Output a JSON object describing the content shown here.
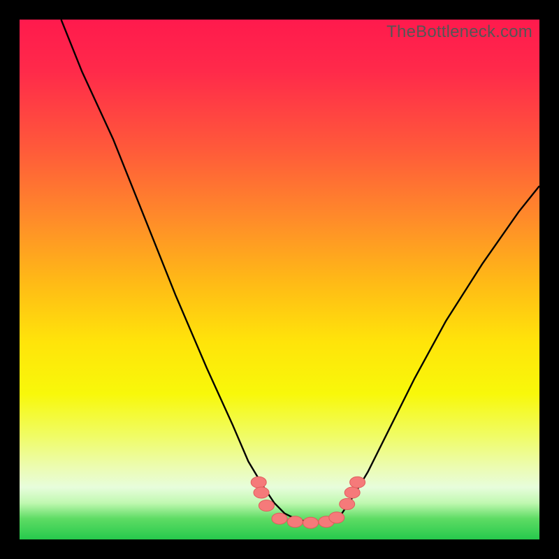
{
  "watermark": "TheBottleneck.com",
  "colors": {
    "frame": "#000000",
    "gradient_top": "#ff1a4d",
    "gradient_mid": "#ffe40a",
    "gradient_bottom": "#26c94c",
    "curve": "#000000",
    "marker_fill": "#f57a7a",
    "marker_stroke": "#e05c5c"
  },
  "chart_data": {
    "type": "line",
    "title": "",
    "xlabel": "",
    "ylabel": "",
    "xlim": [
      0,
      100
    ],
    "ylim": [
      0,
      100
    ],
    "grid": false,
    "legend": false,
    "notes": "Two v-shaped curves descending to a flat minimum near the bottom-center; rounded reddish markers sit along the valley floor. No axis ticks or numeric labels are visible; values are from a 0–100 canvas estimate.",
    "series": [
      {
        "name": "left-curve",
        "x": [
          8,
          12,
          18,
          24,
          30,
          36,
          41,
          44,
          47,
          49,
          51,
          53,
          55,
          58
        ],
        "y": [
          100,
          90,
          77,
          62,
          47,
          33,
          22,
          15,
          10,
          7,
          5,
          4,
          3.5,
          3.2
        ]
      },
      {
        "name": "right-curve",
        "x": [
          58,
          60,
          62,
          64,
          67,
          71,
          76,
          82,
          89,
          96,
          100
        ],
        "y": [
          3.2,
          3.6,
          5,
          8,
          13,
          21,
          31,
          42,
          53,
          63,
          68
        ]
      }
    ],
    "markers": {
      "name": "valley-markers",
      "points": [
        {
          "x": 46,
          "y": 11
        },
        {
          "x": 46.5,
          "y": 9
        },
        {
          "x": 47.5,
          "y": 6.5
        },
        {
          "x": 50,
          "y": 4
        },
        {
          "x": 53,
          "y": 3.4
        },
        {
          "x": 56,
          "y": 3.2
        },
        {
          "x": 59,
          "y": 3.4
        },
        {
          "x": 61,
          "y": 4.2
        },
        {
          "x": 63,
          "y": 6.8
        },
        {
          "x": 64,
          "y": 9
        },
        {
          "x": 65,
          "y": 11
        }
      ]
    }
  }
}
